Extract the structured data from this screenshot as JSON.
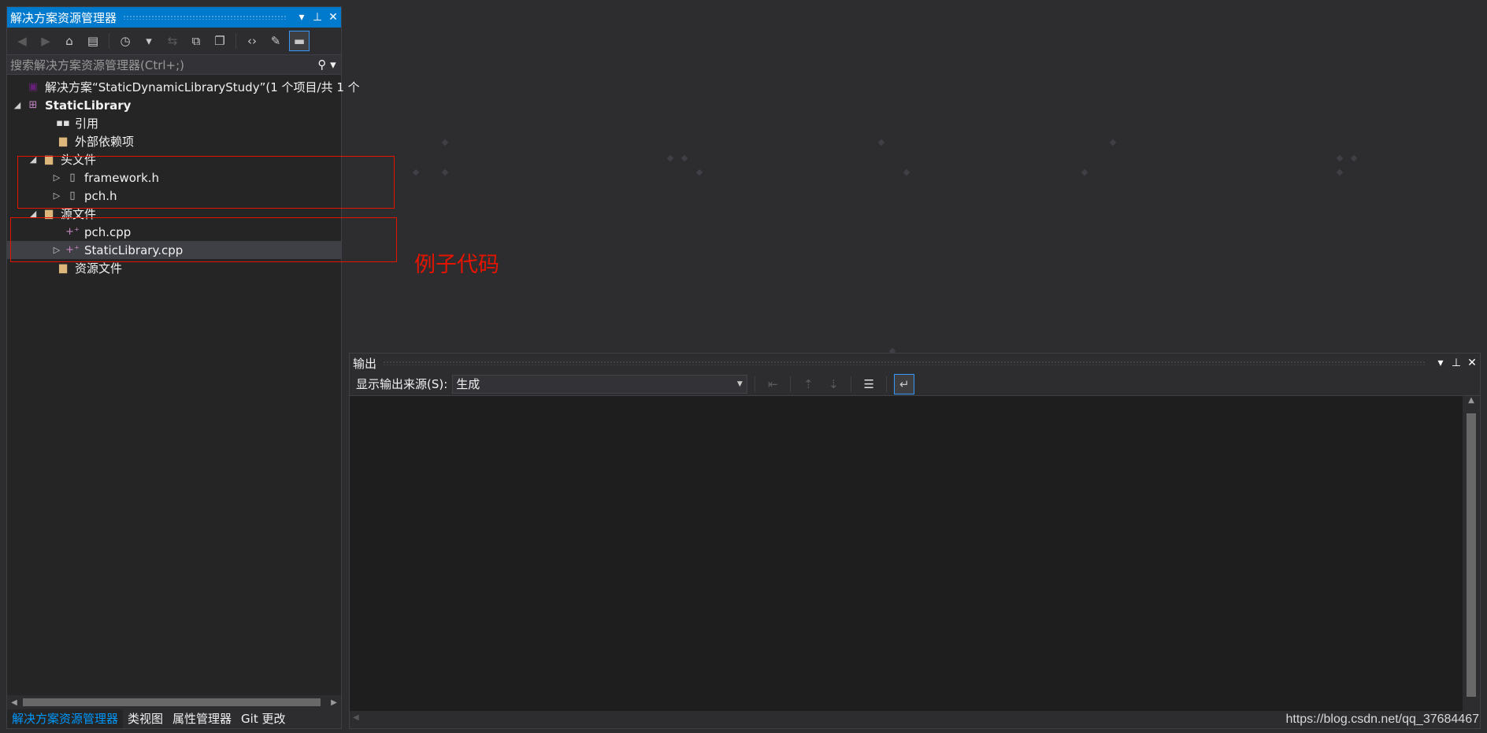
{
  "solution_explorer": {
    "title": "解决方案资源管理器",
    "search_placeholder": "搜索解决方案资源管理器(Ctrl+;)",
    "tree": {
      "solution": "解决方案“StaticDynamicLibraryStudy”(1 个项目/共 1 个",
      "project": "StaticLibrary",
      "references": "引用",
      "external_deps": "外部依赖项",
      "header_folder": "头文件",
      "header_files": [
        "framework.h",
        "pch.h"
      ],
      "source_folder": "源文件",
      "source_files": [
        "pch.cpp",
        "StaticLibrary.cpp"
      ],
      "resource_folder": "资源文件"
    },
    "bottom_tabs": [
      "解决方案资源管理器",
      "类视图",
      "属性管理器",
      "Git 更改"
    ]
  },
  "annotation": {
    "text": "例子代码",
    "color": "#e51400"
  },
  "output": {
    "title": "输出",
    "source_label": "显示输出来源(S):",
    "source_value": "生成"
  },
  "watermark": "https://blog.csdn.net/qq_37684467",
  "colors": {
    "accent": "#007acc",
    "background": "#2d2d30",
    "panel": "#252526",
    "annotation": "#e51400"
  }
}
